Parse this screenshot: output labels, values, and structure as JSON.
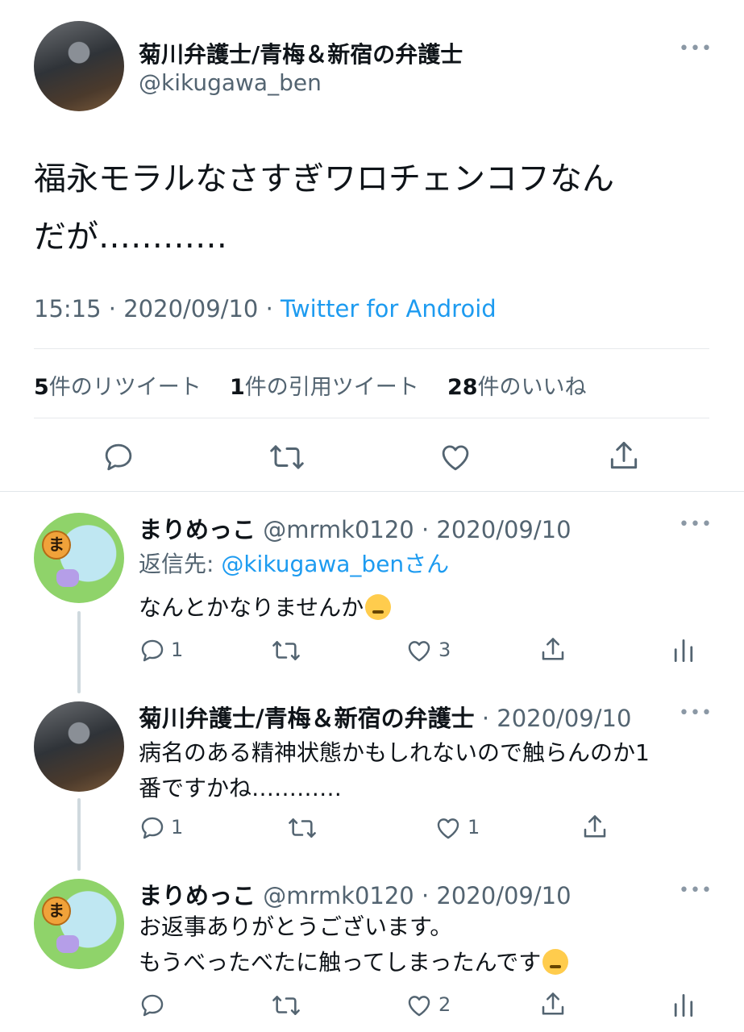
{
  "main_tweet": {
    "display_name": "菊川弁護士/青梅＆新宿の弁護士",
    "handle": "@kikugawa_ben",
    "text_line1": "福永モラルなさすぎワロチェンコフなん",
    "text_line2": "だが…………",
    "time": "15:15",
    "date": "2020/09/10",
    "source": "Twitter for Android",
    "stats": {
      "retweets_count": "5",
      "retweets_label": "件のリツイート",
      "quotes_count": "1",
      "quotes_label": "件の引用ツイート",
      "likes_count": "28",
      "likes_label": "件のいいね"
    }
  },
  "replies": [
    {
      "display_name": "まりめっこ",
      "handle": "@mrmk0120",
      "date": "2020/09/10",
      "reply_to_label": "返信先:",
      "reply_to_handle": "@kikugawa_benさん",
      "text_line1": "なんとかなりませんか",
      "emoji": "crying-face",
      "reply_count": "1",
      "like_count": "3",
      "avatar_badge": "ま"
    },
    {
      "display_name": "菊川弁護士/青梅＆新宿の弁護士",
      "date": "2020/09/10",
      "text_line1": "病名のある精神状態かもしれないので触らんのか1",
      "text_line2": "番ですかね…………",
      "reply_count": "1",
      "like_count": "1"
    },
    {
      "display_name": "まりめっこ",
      "handle": "@mrmk0120",
      "date": "2020/09/10",
      "text_line1": "お返事ありがとうございます。",
      "text_line2": "もうべったべたに触ってしまったんです",
      "emoji": "loudly-crying-face",
      "like_count": "2",
      "avatar_badge": "ま"
    }
  ],
  "colors": {
    "link": "#1d9bf0",
    "muted": "#536471",
    "text": "#0f1419",
    "thread_line": "#cfd9de"
  }
}
